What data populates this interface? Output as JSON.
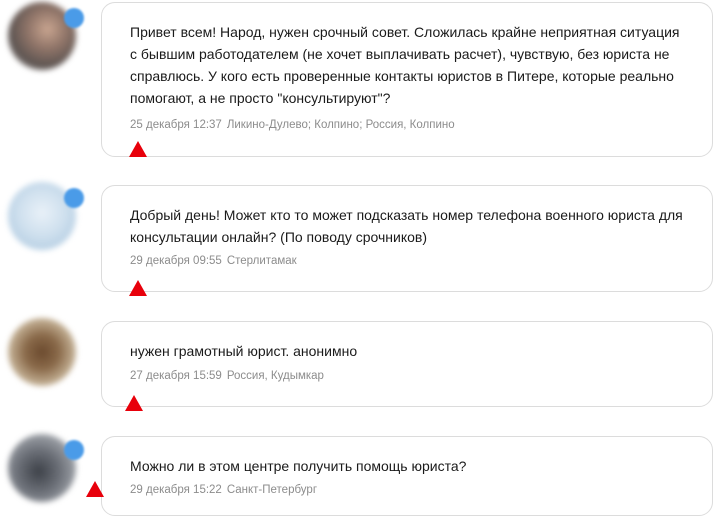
{
  "colors": {
    "card_border": "#dcdcdc",
    "text": "#1a1a1a",
    "meta_text": "#8c8c8c",
    "badge": "#4a9be8",
    "pointer": "#e8000b"
  },
  "posts": [
    {
      "text": "Привет всем! Народ, нужен срочный совет. Сложилась крайне неприятная ситуация с бывшим работодателем (не хочет выплачивать расчет), чувствую, без юриста не справлюсь. У кого есть проверенные контакты юристов в Питере, которые реально помогают, а не просто \"консультируют\"?",
      "date": "25 декабря 12:37",
      "location": "Ликино-Дулево; Колпино; Россия, Колпино",
      "avatar_icon": "user-avatar"
    },
    {
      "text": "Добрый день! Может кто то может подсказать номер телефона военного юриста для консультации онлайн? (По поводу срочников)",
      "date": "29 декабря 09:55",
      "location": "Стерлитамак",
      "avatar_icon": "user-avatar"
    },
    {
      "text": "нужен грамотный юрист. анонимно",
      "date": "27 декабря 15:59",
      "location": "Россия, Кудымкар",
      "avatar_icon": "user-avatar"
    },
    {
      "text": "Можно ли в этом центре получить помощь юриста?",
      "date": "29 декабря 15:22",
      "location": "Санкт-Петербург",
      "avatar_icon": "user-avatar"
    }
  ]
}
